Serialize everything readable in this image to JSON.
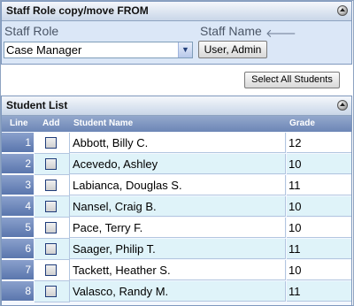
{
  "staff_panel": {
    "title": "Staff Role copy/move FROM",
    "staff_role_label": "Staff Role",
    "staff_role_value": "Case Manager",
    "staff_name_label": "Staff Name",
    "staff_name_button": "User, Admin"
  },
  "actions": {
    "select_all": "Select All Students"
  },
  "student_list": {
    "title": "Student List",
    "columns": {
      "line": "Line",
      "add": "Add",
      "name": "Student Name",
      "grade": "Grade"
    },
    "rows": [
      {
        "line": "1",
        "name": "Abbott, Billy C.",
        "grade": "12"
      },
      {
        "line": "2",
        "name": "Acevedo, Ashley",
        "grade": "10"
      },
      {
        "line": "3",
        "name": "Labianca, Douglas S.",
        "grade": "11"
      },
      {
        "line": "4",
        "name": "Nansel, Craig B.",
        "grade": "10"
      },
      {
        "line": "5",
        "name": "Pace, Terry F.",
        "grade": "10"
      },
      {
        "line": "6",
        "name": "Saager, Philip T.",
        "grade": "11"
      },
      {
        "line": "7",
        "name": "Tackett, Heather S.",
        "grade": "10"
      },
      {
        "line": "8",
        "name": "Valasco, Randy M.",
        "grade": "11"
      }
    ]
  },
  "icons": {
    "panel_toggle": "collapse-toggle-icon",
    "dropdown": "chevron-down-icon",
    "back": "arrow-left-icon"
  }
}
